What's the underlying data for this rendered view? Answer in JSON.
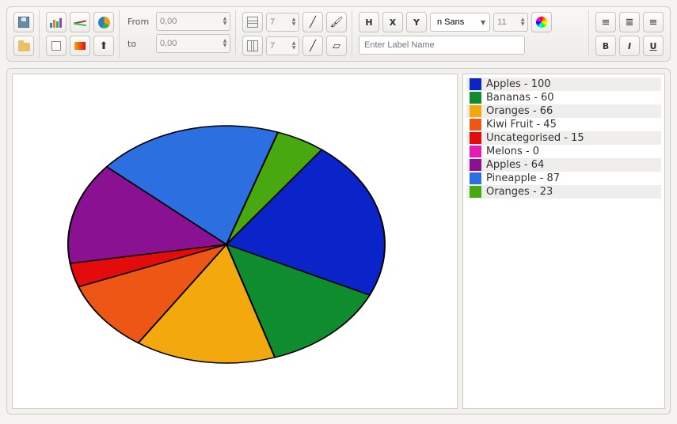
{
  "toolbar": {
    "from_label": "From",
    "from_value": "0,00",
    "to_label": "to",
    "to_value": "0,00",
    "grid_h_value": "7",
    "grid_v_value": "7",
    "axis_h": "H",
    "axis_x": "X",
    "axis_y": "Y",
    "font_family": "n Sans",
    "font_size": "11",
    "label_placeholder": "Enter Label Name",
    "bold": "B",
    "italic": "I",
    "underline": "U"
  },
  "chart_data": {
    "type": "pie",
    "title": "",
    "series": [
      {
        "name": "Apples",
        "value": 100,
        "color": "#0b24c9"
      },
      {
        "name": "Bananas",
        "value": 60,
        "color": "#0f8c2e"
      },
      {
        "name": "Oranges",
        "value": 66,
        "color": "#f3a80e"
      },
      {
        "name": "Kiwi Fruit",
        "value": 45,
        "color": "#ed5614"
      },
      {
        "name": "Uncategorised",
        "value": 15,
        "color": "#e30b0b"
      },
      {
        "name": "Melons",
        "value": 0,
        "color": "#e61bb5"
      },
      {
        "name": "Apples",
        "value": 64,
        "color": "#8a1191"
      },
      {
        "name": "Pineapple",
        "value": 87,
        "color": "#2c6fe0"
      },
      {
        "name": "Oranges",
        "value": 23,
        "color": "#47a80f"
      }
    ]
  },
  "legend_separator": " - "
}
